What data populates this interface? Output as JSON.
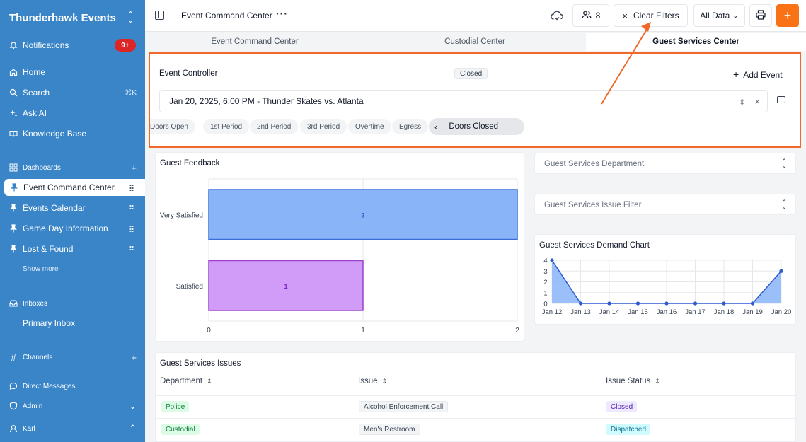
{
  "sidebar": {
    "brand": "Thunderhawk Events",
    "notifications_label": "Notifications",
    "notifications_badge": "9+",
    "home": "Home",
    "search": "Search",
    "search_shortcut": "⌘K",
    "ask_ai": "Ask AI",
    "knowledge_base": "Knowledge Base",
    "dashboards": "Dashboards",
    "pinned": [
      "Event Command Center",
      "Events Calendar",
      "Game Day Information",
      "Lost & Found"
    ],
    "show_more": "Show more",
    "inboxes": "Inboxes",
    "primary_inbox": "Primary Inbox",
    "channels": "Channels",
    "direct_messages": "Direct Messages",
    "admin": "Admin",
    "user": "Karl"
  },
  "topbar": {
    "title": "Event Command Center",
    "members_count": "8",
    "clear_filters": "Clear Filters",
    "all_data": "All Data"
  },
  "tabs": [
    "Event Command Center",
    "Custodial Center",
    "Guest Services Center"
  ],
  "controller": {
    "title": "Event Controller",
    "status": "Closed",
    "add_event": "Add Event",
    "selected_event": "Jan 20, 2025, 6:00 PM - Thunder Skates vs. Atlanta",
    "phases": [
      "Doors Open",
      "1st Period",
      "2nd Period",
      "3rd Period",
      "Overtime",
      "Egress"
    ],
    "current_phase": "Doors Closed"
  },
  "feedback": {
    "title": "Guest Feedback",
    "chart_data": {
      "type": "bar",
      "orientation": "horizontal",
      "categories": [
        "Very Satisfied",
        "Satisfied"
      ],
      "values": [
        2,
        1
      ],
      "xlim": [
        0,
        2
      ],
      "xticks": [
        "0",
        "1",
        "2"
      ],
      "colors": [
        "#8ab4f8",
        "#d09cf7"
      ],
      "border_colors": [
        "#3b6fd8",
        "#9b43c9"
      ],
      "label_colors": [
        "#2f5bd0",
        "#7e22ce"
      ]
    }
  },
  "filters": {
    "department": "Guest Services Department",
    "issue": "Guest Services Issue Filter"
  },
  "demand": {
    "title": "Guest Services Demand Chart",
    "chart_data": {
      "type": "area",
      "x": [
        "Jan 12",
        "Jan 13",
        "Jan 14",
        "Jan 15",
        "Jan 16",
        "Jan 17",
        "Jan 18",
        "Jan 19",
        "Jan 20"
      ],
      "values": [
        4,
        0,
        0,
        0,
        0,
        0,
        0,
        0,
        3
      ],
      "ylim": [
        0,
        4
      ],
      "yticks": [
        "0",
        "1",
        "2",
        "3",
        "4"
      ],
      "color": "#2f5bd0",
      "fill": "#8ab4f8"
    }
  },
  "issues": {
    "title": "Guest Services Issues",
    "columns": [
      "Department",
      "Issue",
      "Issue Status"
    ],
    "rows": [
      {
        "department": "Police",
        "issue": "Alcohol Enforcement Call",
        "status": "Closed"
      },
      {
        "department": "Custodial",
        "issue": "Men's Restroom",
        "status": "Dispatched"
      }
    ]
  },
  "colors": {
    "sidebar": "#3a85c7",
    "accent": "#f97316",
    "highlight": "#f0692a"
  }
}
